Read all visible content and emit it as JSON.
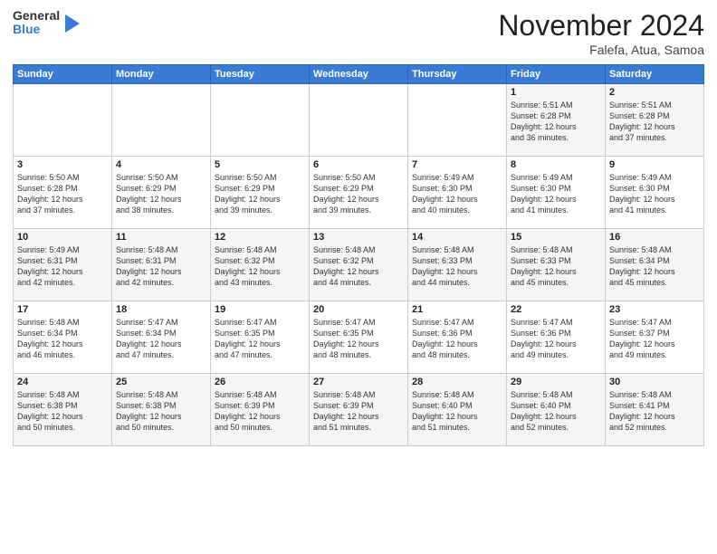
{
  "logo": {
    "general": "General",
    "blue": "Blue"
  },
  "header": {
    "month_year": "November 2024",
    "location": "Falefa, Atua, Samoa"
  },
  "weekdays": [
    "Sunday",
    "Monday",
    "Tuesday",
    "Wednesday",
    "Thursday",
    "Friday",
    "Saturday"
  ],
  "weeks": [
    [
      {
        "day": "",
        "info": ""
      },
      {
        "day": "",
        "info": ""
      },
      {
        "day": "",
        "info": ""
      },
      {
        "day": "",
        "info": ""
      },
      {
        "day": "",
        "info": ""
      },
      {
        "day": "1",
        "info": "Sunrise: 5:51 AM\nSunset: 6:28 PM\nDaylight: 12 hours\nand 36 minutes."
      },
      {
        "day": "2",
        "info": "Sunrise: 5:51 AM\nSunset: 6:28 PM\nDaylight: 12 hours\nand 37 minutes."
      }
    ],
    [
      {
        "day": "3",
        "info": "Sunrise: 5:50 AM\nSunset: 6:28 PM\nDaylight: 12 hours\nand 37 minutes."
      },
      {
        "day": "4",
        "info": "Sunrise: 5:50 AM\nSunset: 6:29 PM\nDaylight: 12 hours\nand 38 minutes."
      },
      {
        "day": "5",
        "info": "Sunrise: 5:50 AM\nSunset: 6:29 PM\nDaylight: 12 hours\nand 39 minutes."
      },
      {
        "day": "6",
        "info": "Sunrise: 5:50 AM\nSunset: 6:29 PM\nDaylight: 12 hours\nand 39 minutes."
      },
      {
        "day": "7",
        "info": "Sunrise: 5:49 AM\nSunset: 6:30 PM\nDaylight: 12 hours\nand 40 minutes."
      },
      {
        "day": "8",
        "info": "Sunrise: 5:49 AM\nSunset: 6:30 PM\nDaylight: 12 hours\nand 41 minutes."
      },
      {
        "day": "9",
        "info": "Sunrise: 5:49 AM\nSunset: 6:30 PM\nDaylight: 12 hours\nand 41 minutes."
      }
    ],
    [
      {
        "day": "10",
        "info": "Sunrise: 5:49 AM\nSunset: 6:31 PM\nDaylight: 12 hours\nand 42 minutes."
      },
      {
        "day": "11",
        "info": "Sunrise: 5:48 AM\nSunset: 6:31 PM\nDaylight: 12 hours\nand 42 minutes."
      },
      {
        "day": "12",
        "info": "Sunrise: 5:48 AM\nSunset: 6:32 PM\nDaylight: 12 hours\nand 43 minutes."
      },
      {
        "day": "13",
        "info": "Sunrise: 5:48 AM\nSunset: 6:32 PM\nDaylight: 12 hours\nand 44 minutes."
      },
      {
        "day": "14",
        "info": "Sunrise: 5:48 AM\nSunset: 6:33 PM\nDaylight: 12 hours\nand 44 minutes."
      },
      {
        "day": "15",
        "info": "Sunrise: 5:48 AM\nSunset: 6:33 PM\nDaylight: 12 hours\nand 45 minutes."
      },
      {
        "day": "16",
        "info": "Sunrise: 5:48 AM\nSunset: 6:34 PM\nDaylight: 12 hours\nand 45 minutes."
      }
    ],
    [
      {
        "day": "17",
        "info": "Sunrise: 5:48 AM\nSunset: 6:34 PM\nDaylight: 12 hours\nand 46 minutes."
      },
      {
        "day": "18",
        "info": "Sunrise: 5:47 AM\nSunset: 6:34 PM\nDaylight: 12 hours\nand 47 minutes."
      },
      {
        "day": "19",
        "info": "Sunrise: 5:47 AM\nSunset: 6:35 PM\nDaylight: 12 hours\nand 47 minutes."
      },
      {
        "day": "20",
        "info": "Sunrise: 5:47 AM\nSunset: 6:35 PM\nDaylight: 12 hours\nand 48 minutes."
      },
      {
        "day": "21",
        "info": "Sunrise: 5:47 AM\nSunset: 6:36 PM\nDaylight: 12 hours\nand 48 minutes."
      },
      {
        "day": "22",
        "info": "Sunrise: 5:47 AM\nSunset: 6:36 PM\nDaylight: 12 hours\nand 49 minutes."
      },
      {
        "day": "23",
        "info": "Sunrise: 5:47 AM\nSunset: 6:37 PM\nDaylight: 12 hours\nand 49 minutes."
      }
    ],
    [
      {
        "day": "24",
        "info": "Sunrise: 5:48 AM\nSunset: 6:38 PM\nDaylight: 12 hours\nand 50 minutes."
      },
      {
        "day": "25",
        "info": "Sunrise: 5:48 AM\nSunset: 6:38 PM\nDaylight: 12 hours\nand 50 minutes."
      },
      {
        "day": "26",
        "info": "Sunrise: 5:48 AM\nSunset: 6:39 PM\nDaylight: 12 hours\nand 50 minutes."
      },
      {
        "day": "27",
        "info": "Sunrise: 5:48 AM\nSunset: 6:39 PM\nDaylight: 12 hours\nand 51 minutes."
      },
      {
        "day": "28",
        "info": "Sunrise: 5:48 AM\nSunset: 6:40 PM\nDaylight: 12 hours\nand 51 minutes."
      },
      {
        "day": "29",
        "info": "Sunrise: 5:48 AM\nSunset: 6:40 PM\nDaylight: 12 hours\nand 52 minutes."
      },
      {
        "day": "30",
        "info": "Sunrise: 5:48 AM\nSunset: 6:41 PM\nDaylight: 12 hours\nand 52 minutes."
      }
    ]
  ]
}
